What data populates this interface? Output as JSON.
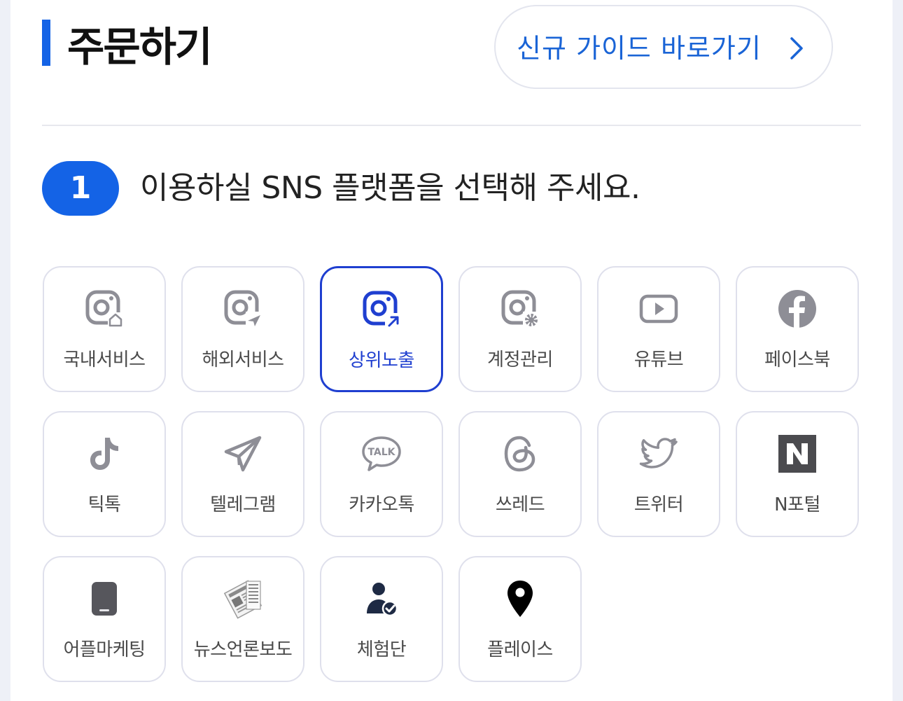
{
  "header": {
    "title": "주문하기",
    "guide_button_label": "신규 가이드 바로가기"
  },
  "step": {
    "number": "1",
    "text": "이용하실 SNS 플랫폼을 선택해 주세요."
  },
  "colors": {
    "accent": "#1463e6",
    "selected": "#1f3fd0",
    "icon_gray": "#8e8e96"
  },
  "platforms": [
    {
      "label": "국내서비스",
      "icon": "instagram-home-icon",
      "selected": false
    },
    {
      "label": "해외서비스",
      "icon": "instagram-plane-icon",
      "selected": false
    },
    {
      "label": "상위노출",
      "icon": "instagram-arrow-icon",
      "selected": true
    },
    {
      "label": "계정관리",
      "icon": "instagram-gear-icon",
      "selected": false
    },
    {
      "label": "유튜브",
      "icon": "youtube-icon",
      "selected": false
    },
    {
      "label": "페이스북",
      "icon": "facebook-icon",
      "selected": false
    },
    {
      "label": "틱톡",
      "icon": "tiktok-icon",
      "selected": false
    },
    {
      "label": "텔레그램",
      "icon": "telegram-icon",
      "selected": false
    },
    {
      "label": "카카오톡",
      "icon": "kakaotalk-icon",
      "selected": false
    },
    {
      "label": "쓰레드",
      "icon": "threads-icon",
      "selected": false
    },
    {
      "label": "트위터",
      "icon": "twitter-icon",
      "selected": false
    },
    {
      "label": "N포털",
      "icon": "naver-icon",
      "selected": false
    },
    {
      "label": "어플마케팅",
      "icon": "smartphone-icon",
      "selected": false
    },
    {
      "label": "뉴스언론보도",
      "icon": "newspaper-icon",
      "selected": false
    },
    {
      "label": "체험단",
      "icon": "user-check-icon",
      "selected": false
    },
    {
      "label": "플레이스",
      "icon": "map-pin-icon",
      "selected": false
    }
  ]
}
